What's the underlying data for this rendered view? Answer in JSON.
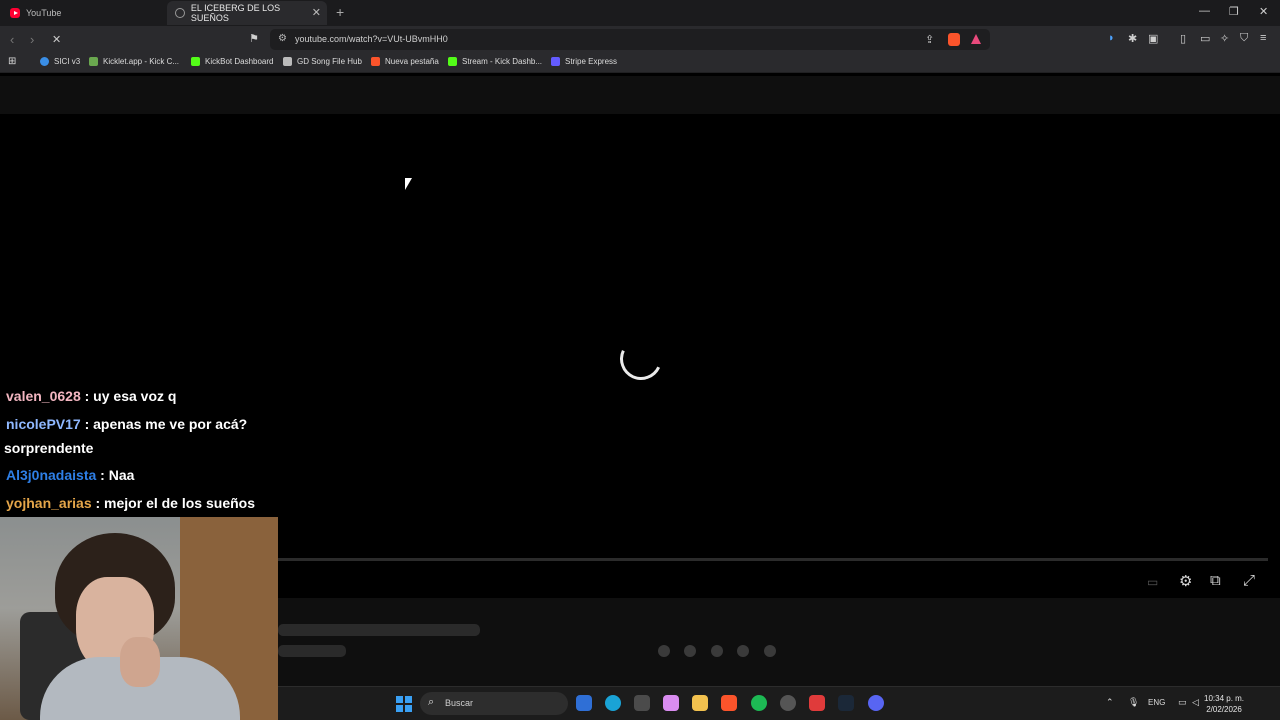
{
  "browser": {
    "tabs": [
      {
        "title": "YouTube",
        "active": false
      },
      {
        "title": "EL ICEBERG DE LOS SUEÑOS",
        "active": true
      }
    ],
    "url": "youtube.com/watch?v=VUt-UBvmHH0",
    "bookmarks": [
      {
        "label": "SICI v3",
        "color": "#3a8ee6"
      },
      {
        "label": "Kicklet.app - Kick C...",
        "color": "#6aa84f"
      },
      {
        "label": "KickBot Dashboard",
        "color": "#53fc18"
      },
      {
        "label": "GD Song File Hub",
        "color": "#bbbbbb"
      },
      {
        "label": "Nueva pestaña",
        "color": "#fb542b"
      },
      {
        "label": "Stream - Kick Dashb...",
        "color": "#53fc18"
      },
      {
        "label": "Stripe Express",
        "color": "#635bff"
      }
    ]
  },
  "chat": [
    {
      "user": "valen_0628",
      "user_color": "#f3b6c1",
      "text": " : uy esa voz q"
    },
    {
      "user": "nicolePV17",
      "user_color": "#8fb8ff",
      "text": " : apenas me ve por acá?"
    },
    {
      "user": "",
      "user_color": "#ffffff",
      "text": "sorprendente"
    },
    {
      "user": "Al3j0nadaista",
      "user_color": "#2e7fe6",
      "text": " : Naa"
    },
    {
      "user": "yojhan_arias",
      "user_color": "#e5a64a",
      "text": " : mejor el de los sueños"
    }
  ],
  "taskbar": {
    "search_placeholder": "Buscar",
    "language": "ENG",
    "time": "10:34 p. m.",
    "date": "2/02/2026"
  },
  "icons": {
    "player_controls": [
      "subtitles-icon",
      "settings-gear-icon",
      "miniplayer-icon",
      "fullscreen-icon"
    ]
  }
}
